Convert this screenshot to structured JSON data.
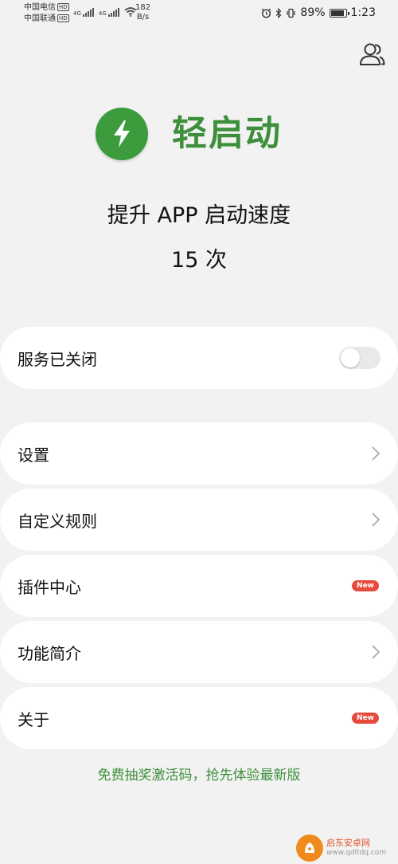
{
  "status_bar": {
    "carrier1": "中国电信",
    "carrier2": "中国联通",
    "hd_label": "HD",
    "net_type": "4G",
    "net_speed_value": "182",
    "net_speed_unit": "B/s",
    "battery": "89%",
    "time": "1:23"
  },
  "app": {
    "name": "轻启动",
    "tagline": "提升 APP 启动速度",
    "count": "15 次"
  },
  "service": {
    "label": "服务已关闭",
    "enabled": false
  },
  "menu": [
    {
      "label": "设置",
      "trailing": "chevron"
    },
    {
      "label": "自定义规则",
      "trailing": "chevron"
    },
    {
      "label": "插件中心",
      "trailing": "new-badge"
    },
    {
      "label": "功能简介",
      "trailing": "chevron"
    },
    {
      "label": "关于",
      "trailing": "new-badge"
    }
  ],
  "new_badge": "New",
  "promo": "免费抽奖激活码，抢先体验最新版",
  "watermark": {
    "title": "启东安卓网",
    "url": "www.qdltdq.com"
  },
  "colors": {
    "brand_green": "#3e8f3b",
    "logo_green": "#3c9c3d",
    "badge_red": "#e64a3c",
    "background": "#f2f2f2"
  }
}
